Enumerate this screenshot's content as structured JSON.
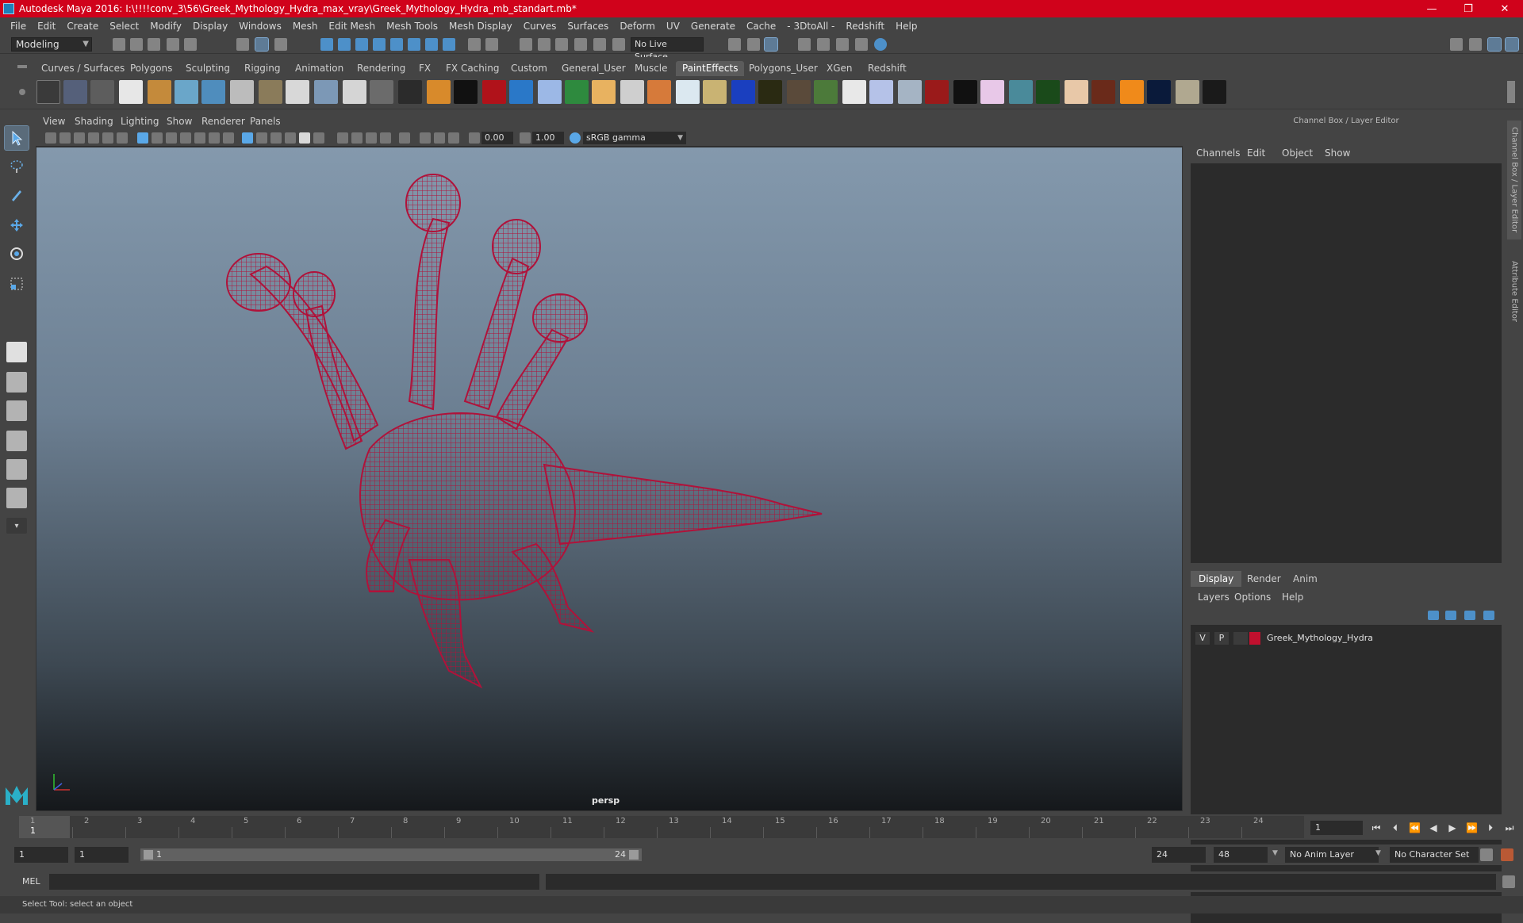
{
  "window": {
    "title": "Autodesk Maya 2016: I:\\!!!!conv_3\\56\\Greek_Mythology_Hydra_max_vray\\Greek_Mythology_Hydra_mb_standart.mb*",
    "min": "—",
    "max": "❐",
    "close": "✕"
  },
  "menu": [
    "File",
    "Edit",
    "Create",
    "Select",
    "Modify",
    "Display",
    "Windows",
    "Mesh",
    "Edit Mesh",
    "Mesh Tools",
    "Mesh Display",
    "Curves",
    "Surfaces",
    "Deform",
    "UV",
    "Generate",
    "Cache",
    "- 3DtoAll -",
    "Redshift",
    "Help"
  ],
  "status": {
    "mode": "Modeling",
    "live_surface": "No Live Surface"
  },
  "shelf_tabs": [
    "Curves / Surfaces",
    "Polygons",
    "Sculpting",
    "Rigging",
    "Animation",
    "Rendering",
    "FX",
    "FX Caching",
    "Custom",
    "General_User",
    "Muscle",
    "PaintEffects",
    "Polygons_User",
    "XGen",
    "Redshift"
  ],
  "shelf_active_tab": "PaintEffects",
  "panel_menu": [
    "View",
    "Shading",
    "Lighting",
    "Show",
    "Renderer",
    "Panels"
  ],
  "viewport": {
    "exposure": "0.00",
    "gamma": "1.00",
    "color_space": "sRGB gamma",
    "camera": "persp",
    "mesh_color": "#b0123a"
  },
  "channel_box": {
    "title": "Channel Box / Layer Editor",
    "menu": [
      "Channels",
      "Edit",
      "Object",
      "Show"
    ]
  },
  "layer_editor": {
    "tabs": [
      "Display",
      "Render",
      "Anim"
    ],
    "active_tab": "Display",
    "menu": [
      "Layers",
      "Options",
      "Help"
    ],
    "layer": {
      "visible": "V",
      "playback": "P",
      "name": "Greek_Mythology_Hydra",
      "color": "#c0102e"
    }
  },
  "side_tabs": [
    "Channel Box / Layer Editor",
    "Attribute Editor"
  ],
  "timeline": {
    "ticks": [
      "1",
      "2",
      "3",
      "4",
      "5",
      "6",
      "7",
      "8",
      "9",
      "10",
      "11",
      "12",
      "13",
      "14",
      "15",
      "16",
      "17",
      "18",
      "19",
      "20",
      "21",
      "22",
      "23",
      "24"
    ],
    "current_frame_label": "1",
    "current_frame_field": "1"
  },
  "range": {
    "start": "1",
    "playback_start": "1",
    "slider_start": "1",
    "slider_end": "24",
    "playback_end": "24",
    "end": "48",
    "anim_layer": "No Anim Layer",
    "character_set": "No Character Set"
  },
  "cmd": {
    "lang": "MEL"
  },
  "help": {
    "text": "Select Tool: select an object"
  }
}
